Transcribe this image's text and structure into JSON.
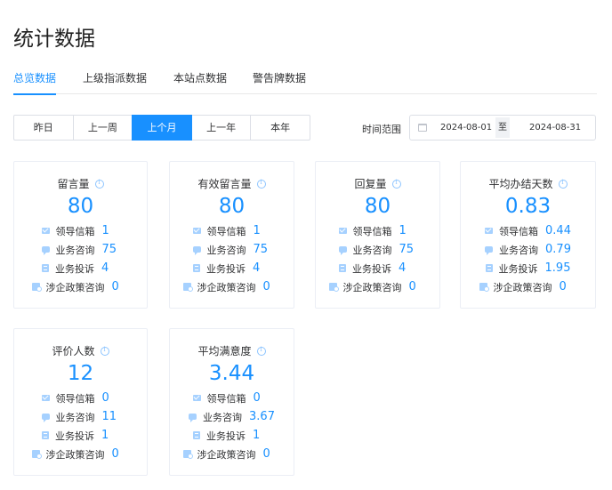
{
  "page": {
    "title": "统计数据"
  },
  "tabs": [
    {
      "label": "总览数据",
      "active": true
    },
    {
      "label": "上级指派数据",
      "active": false
    },
    {
      "label": "本站点数据",
      "active": false
    },
    {
      "label": "警告牌数据",
      "active": false
    }
  ],
  "range_buttons": [
    {
      "label": "昨日",
      "active": false
    },
    {
      "label": "上一周",
      "active": false
    },
    {
      "label": "上个月",
      "active": true
    },
    {
      "label": "上一年",
      "active": false
    },
    {
      "label": "本年",
      "active": false
    }
  ],
  "date_filter": {
    "label": "时间范围",
    "start": "2024-08-01",
    "separator": "至",
    "end": "2024-08-31"
  },
  "colors": {
    "accent": "#1890ff",
    "icon": "#a6d1ff",
    "border": "#ebeef5"
  },
  "cards": [
    {
      "title": "留言量",
      "value": "80",
      "rows": [
        {
          "icon": "mail-icon",
          "label": "领导信箱",
          "value": "1"
        },
        {
          "icon": "chat-icon",
          "label": "业务咨询",
          "value": "75"
        },
        {
          "icon": "document-icon",
          "label": "业务投诉",
          "value": "4"
        },
        {
          "icon": "policy-icon",
          "label": "涉企政策咨询",
          "value": "0"
        }
      ]
    },
    {
      "title": "有效留言量",
      "value": "80",
      "rows": [
        {
          "icon": "mail-icon",
          "label": "领导信箱",
          "value": "1"
        },
        {
          "icon": "chat-icon",
          "label": "业务咨询",
          "value": "75"
        },
        {
          "icon": "document-icon",
          "label": "业务投诉",
          "value": "4"
        },
        {
          "icon": "policy-icon",
          "label": "涉企政策咨询",
          "value": "0"
        }
      ]
    },
    {
      "title": "回复量",
      "value": "80",
      "rows": [
        {
          "icon": "mail-icon",
          "label": "领导信箱",
          "value": "1"
        },
        {
          "icon": "chat-icon",
          "label": "业务咨询",
          "value": "75"
        },
        {
          "icon": "document-icon",
          "label": "业务投诉",
          "value": "4"
        },
        {
          "icon": "policy-icon",
          "label": "涉企政策咨询",
          "value": "0"
        }
      ]
    },
    {
      "title": "平均办结天数",
      "value": "0.83",
      "rows": [
        {
          "icon": "mail-icon",
          "label": "领导信箱",
          "value": "0.44"
        },
        {
          "icon": "chat-icon",
          "label": "业务咨询",
          "value": "0.79"
        },
        {
          "icon": "document-icon",
          "label": "业务投诉",
          "value": "1.95"
        },
        {
          "icon": "policy-icon",
          "label": "涉企政策咨询",
          "value": "0"
        }
      ]
    },
    {
      "title": "评价人数",
      "value": "12",
      "rows": [
        {
          "icon": "mail-icon",
          "label": "领导信箱",
          "value": "0"
        },
        {
          "icon": "chat-icon",
          "label": "业务咨询",
          "value": "11"
        },
        {
          "icon": "document-icon",
          "label": "业务投诉",
          "value": "1"
        },
        {
          "icon": "policy-icon",
          "label": "涉企政策咨询",
          "value": "0"
        }
      ]
    },
    {
      "title": "平均满意度",
      "value": "3.44",
      "rows": [
        {
          "icon": "mail-icon",
          "label": "领导信箱",
          "value": "0"
        },
        {
          "icon": "chat-icon",
          "label": "业务咨询",
          "value": "3.67"
        },
        {
          "icon": "document-icon",
          "label": "业务投诉",
          "value": "1"
        },
        {
          "icon": "policy-icon",
          "label": "涉企政策咨询",
          "value": "0"
        }
      ]
    }
  ]
}
